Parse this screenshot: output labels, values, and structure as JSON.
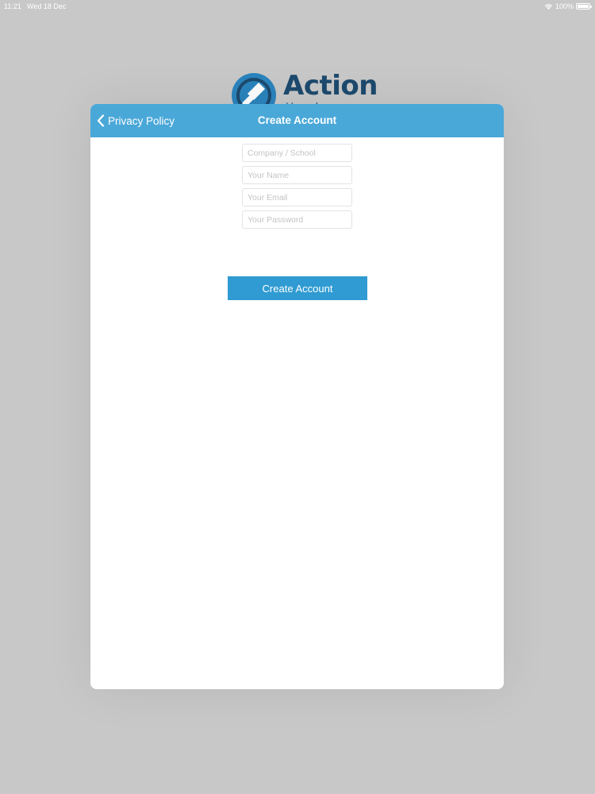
{
  "status_bar": {
    "time": "11:21",
    "date": "Wed 18 Dec",
    "battery": "100%"
  },
  "logo": {
    "word": "Action",
    "sub": "Help Desk"
  },
  "header": {
    "back_label": "Privacy Policy",
    "title": "Create Account",
    "color": "#4aa8d8"
  },
  "form": {
    "company": {
      "placeholder": "Company / School",
      "value": ""
    },
    "name": {
      "placeholder": "Your Name",
      "value": ""
    },
    "email": {
      "placeholder": "Your Email",
      "value": ""
    },
    "password": {
      "placeholder": "Your Password",
      "value": ""
    }
  },
  "submit": {
    "label": "Create Account",
    "color": "#2f9bd2"
  }
}
